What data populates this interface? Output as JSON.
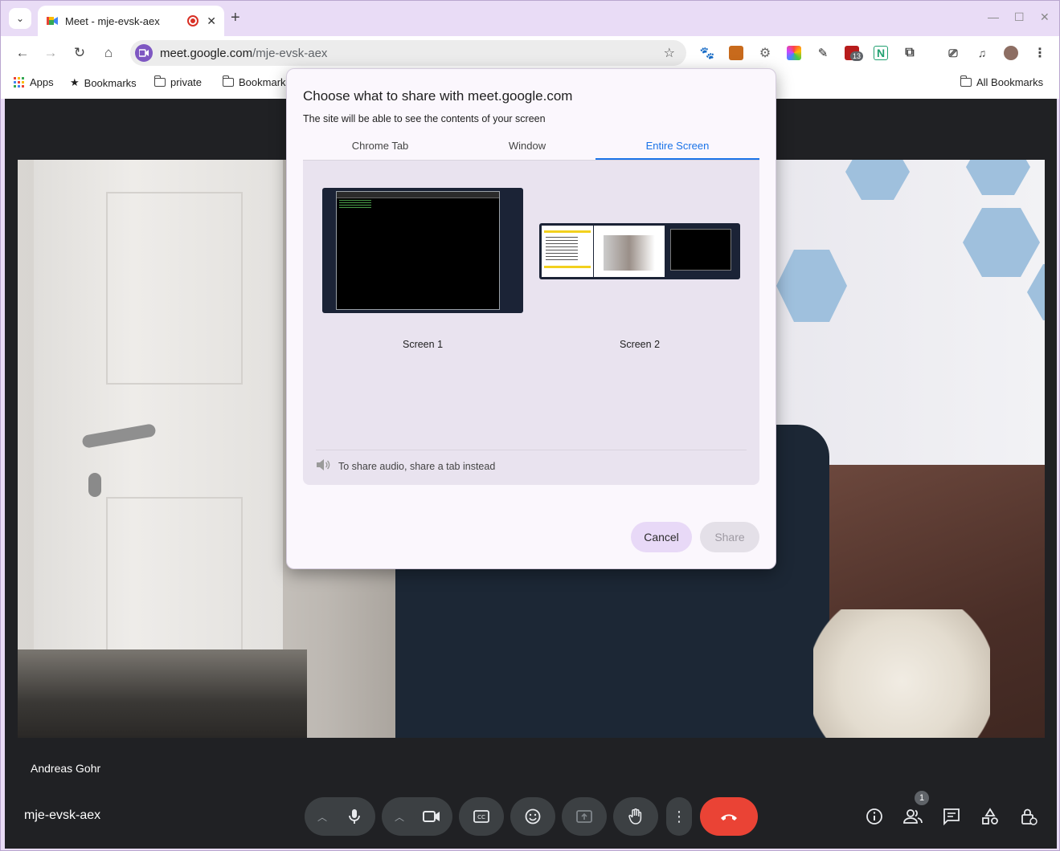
{
  "browser": {
    "tab_title": "Meet - mje-evsk-aex",
    "url_host": "meet.google.com",
    "url_path": "/mje-evsk-aex",
    "ext_badge": "13"
  },
  "bookmarks": {
    "apps": "Apps",
    "bookmarks": "Bookmarks",
    "private": "private",
    "bookmarks2": "Bookmarks",
    "all": "All Bookmarks"
  },
  "dialog": {
    "title": "Choose what to share with meet.google.com",
    "subtitle": "The site will be able to see the contents of your screen",
    "tabs": [
      "Chrome Tab",
      "Window",
      "Entire Screen"
    ],
    "active_tab": "Entire Screen",
    "screens": [
      "Screen 1",
      "Screen 2"
    ],
    "audio_hint": "To share audio, share a tab instead",
    "cancel": "Cancel",
    "share": "Share"
  },
  "meet": {
    "participant_name": "Andreas Gohr",
    "meeting_code": "mje-evsk-aex",
    "people_count": "1"
  },
  "colors": {
    "accent": "#1a73e8",
    "end_call": "#ea4335",
    "tab_strip": "#e9dcf6"
  }
}
